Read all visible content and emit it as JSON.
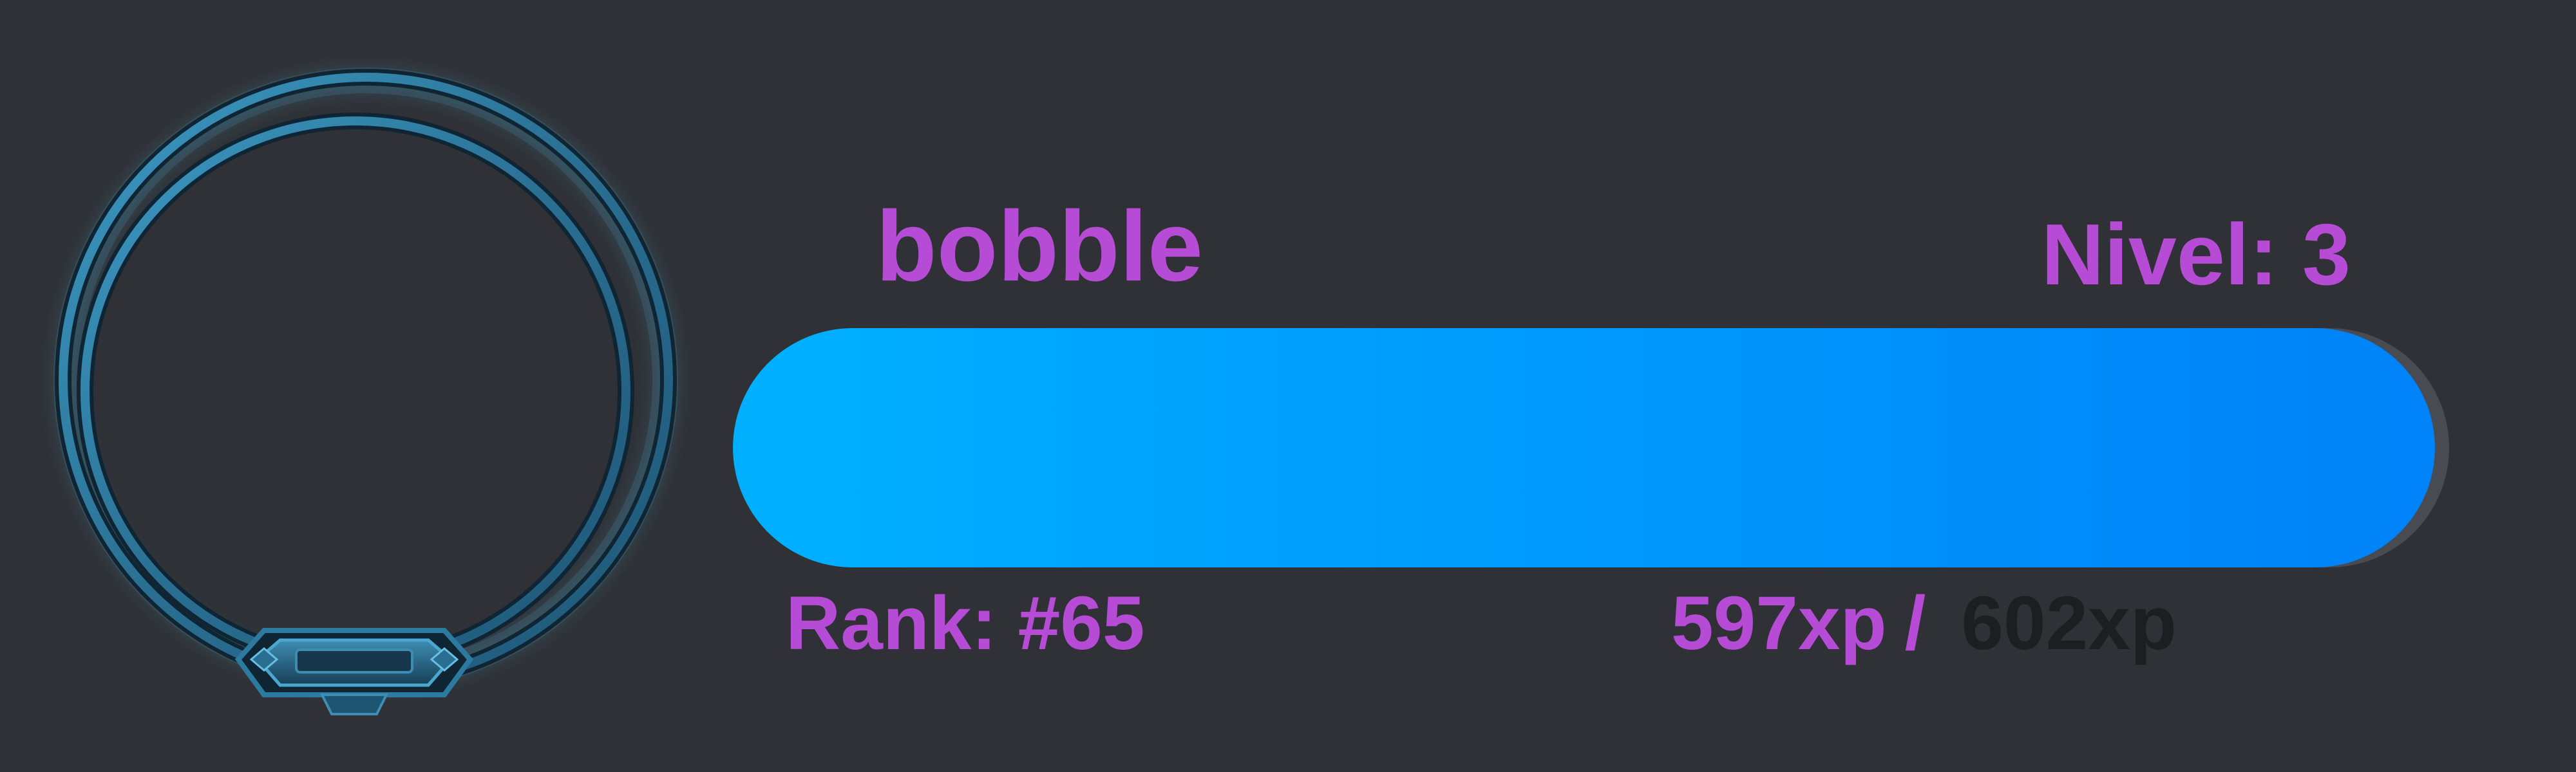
{
  "colors": {
    "background": "#2f3136",
    "accent": "#b64bd6",
    "bar_start": "#00b0ff",
    "bar_end": "#0082f8",
    "track": "#484b51",
    "xp_max_color": "#1d1e21",
    "frame": "#2e7ea3"
  },
  "profile": {
    "username": "bobble",
    "level_label": "Nivel:",
    "level_value": "3",
    "rank_text": "Rank: #65"
  },
  "xp": {
    "current_text": "597xp",
    "separator": "/",
    "max_text": "602xp",
    "progress_fraction": 0.9917
  },
  "icons": {
    "avatar_frame": "ornate-ring-frame-icon"
  }
}
